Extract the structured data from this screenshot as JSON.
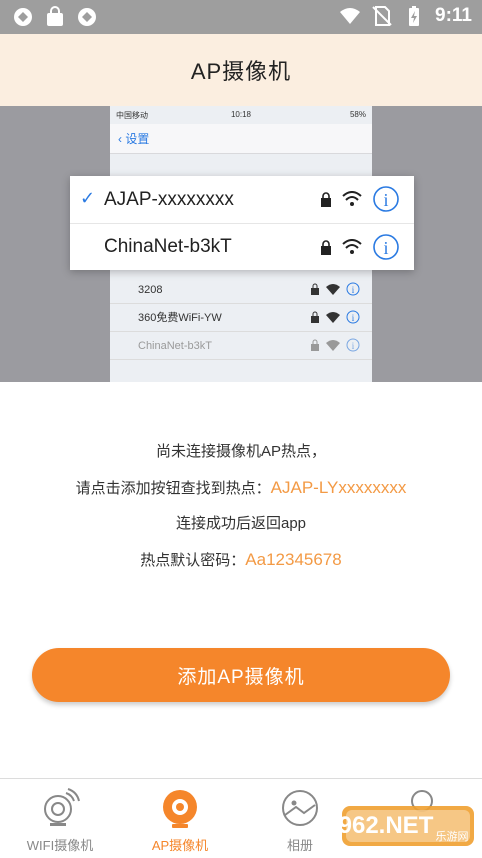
{
  "status_bar": {
    "time": "9:11"
  },
  "header": {
    "title": "AP摄像机"
  },
  "illustration": {
    "phone_status": {
      "carrier": "中国移动",
      "time": "10:18",
      "battery": "58%"
    },
    "nav": {
      "back_label": "设置"
    },
    "card_networks": [
      {
        "name": "AJAP-xxxxxxxx",
        "selected": true
      },
      {
        "name": "ChinaNet-b3kT",
        "selected": false
      }
    ],
    "list_networks": [
      "3208",
      "360免费WiFi-YW",
      "ChinaNet-b3kT"
    ]
  },
  "info": {
    "line1": "尚未连接摄像机AP热点，",
    "line2_prefix": "请点击添加按钮查找到热点：",
    "line2_ssid": "AJAP-LYxxxxxxxx",
    "line3": "连接成功后返回app",
    "line4_prefix": "热点默认密码：",
    "line4_password": "Aa12345678"
  },
  "add_button": {
    "label": "添加AP摄像机"
  },
  "bottom_nav": {
    "items": [
      {
        "label": "WIFI摄像机",
        "icon": "wifi-camera-icon",
        "active": false
      },
      {
        "label": "AP摄像机",
        "icon": "ap-camera-icon",
        "active": true
      },
      {
        "label": "相册",
        "icon": "album-icon",
        "active": false
      },
      {
        "label": "",
        "icon": "profile-icon",
        "active": false
      }
    ]
  },
  "watermark": {
    "text": "962.NET",
    "subtext": "乐游网"
  },
  "colors": {
    "accent": "#f5862b",
    "header_bg": "#fbeee0",
    "highlight_text": "#f39a45",
    "ios_blue": "#2a7ae2"
  }
}
